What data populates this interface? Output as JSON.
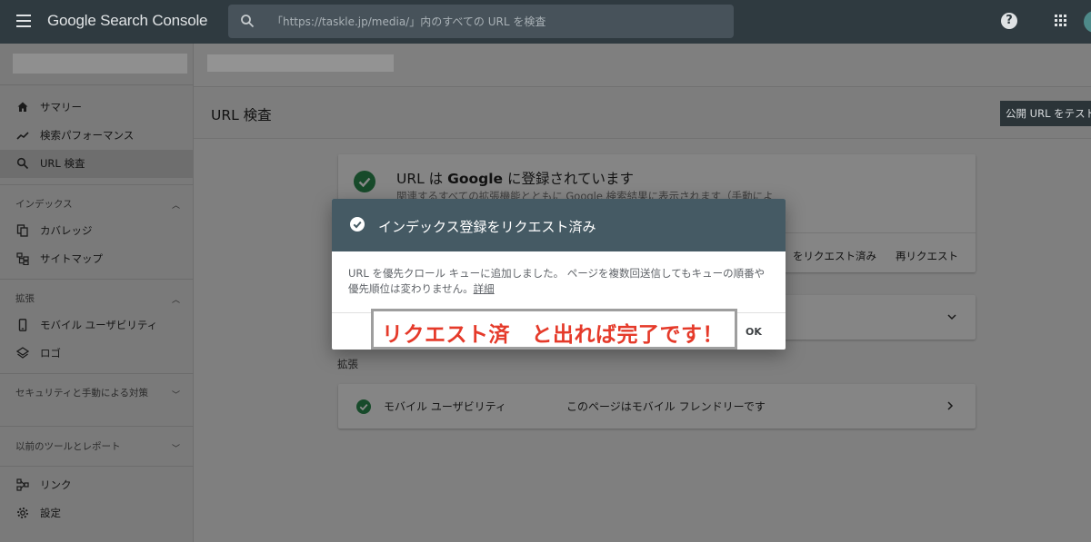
{
  "app": {
    "title": "Google Search Console",
    "search_placeholder": "「https://taskle.jp/media/」内のすべての URL を検査",
    "help_glyph": "?"
  },
  "sidebar": {
    "nav": [
      {
        "label": "サマリー",
        "icon": "home-icon"
      },
      {
        "label": "検索パフォーマンス",
        "icon": "trending-up-icon"
      },
      {
        "label": "URL 検査",
        "icon": "search-icon",
        "active": true
      }
    ],
    "sections": [
      {
        "title": "インデックス",
        "chevron": "up",
        "items": [
          {
            "label": "カバレッジ",
            "icon": "copy-icon"
          },
          {
            "label": "サイトマップ",
            "icon": "sitemap-icon"
          }
        ]
      },
      {
        "title": "拡張",
        "chevron": "up",
        "items": [
          {
            "label": "モバイル ユーザビリティ",
            "icon": "smartphone-icon"
          },
          {
            "label": "ロゴ",
            "icon": "layers-icon"
          }
        ]
      },
      {
        "title": "セキュリティと手動による対策",
        "chevron": "down",
        "items": []
      },
      {
        "title": "以前のツールとレポート",
        "chevron": "down",
        "items": []
      }
    ],
    "footer": [
      {
        "label": "リンク",
        "icon": "links-icon"
      },
      {
        "label": "設定",
        "icon": "gear-icon"
      }
    ]
  },
  "main": {
    "page_title": "URL 検査",
    "test_live_button": "公開 URL をテスト",
    "status_card": {
      "title_prefix": "URL は ",
      "title_bold": "Google",
      "title_suffix": " に登録されています",
      "subtitle": "関連するすべての拡張機能とともに Google 検索結果に表示されます（手動によ",
      "request_status": "をリクエスト済み",
      "rerequest_button": "再リクエスト"
    },
    "enhancements_label": "拡張",
    "mobile_card": {
      "label": "モバイル ユーザビリティ",
      "value": "このページはモバイル フレンドリーです"
    }
  },
  "dialog": {
    "title": "インデックス登録をリクエスト済み",
    "body": "URL を優先クロール キューに追加しました。 ページを複数回送信してもキューの順番や優先順位は変わりません。",
    "link": "詳細",
    "ok_button": "OK"
  },
  "annotation": {
    "text": "リクエスト済　と出れば完了です！",
    "color": "#e53a2a"
  },
  "colors": {
    "topbar": "#2f3a40",
    "dialog_header": "#455a64",
    "success_green": "#174a2a"
  }
}
